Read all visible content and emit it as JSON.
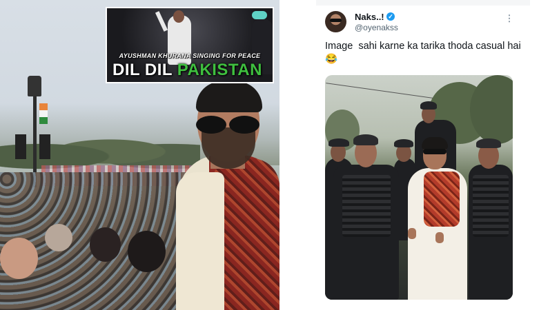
{
  "inset_meme": {
    "caption": "AYUSHMAN KHURANA SINGING FOR PEACE",
    "headline_part1": "DIL DIL ",
    "headline_part2": "PAKISTAN"
  },
  "tweet": {
    "user_name": "Naks..!",
    "user_handle": "@oyenakss",
    "text": "Image  sahi karne ka tarika thoda casual hai😂"
  },
  "colors": {
    "verified_badge": "#1d9bf0",
    "headline_white": "#ffffff",
    "headline_green": "#3fbf3f",
    "handle_gray": "#536471"
  },
  "icons": {
    "verified": "check-badge-icon",
    "more": "three-dots-vertical-icon"
  }
}
